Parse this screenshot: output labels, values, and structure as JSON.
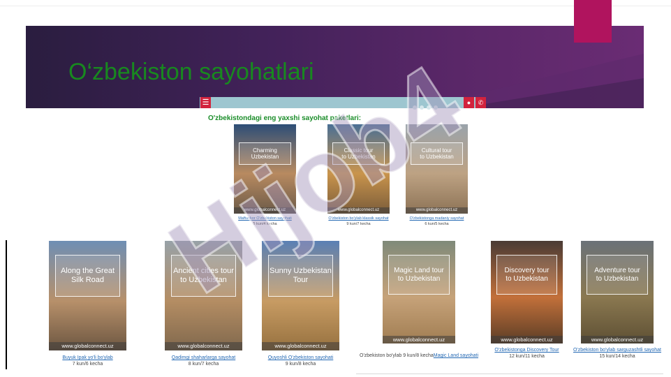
{
  "slide": {
    "title": "O‘zbekiston sayohatlari",
    "colors": {
      "banner": "#43225a",
      "accent": "#b0145e",
      "title": "#18891f",
      "link": "#2368b3",
      "site_bar": "#9dc6d0",
      "site_button": "#d2233d"
    }
  },
  "website": {
    "heading": "O'zbekistondagi eng yaxshi sayohat paketlari:",
    "menu_icon": "hamburger-menu-icon",
    "location_icon": "map-pin-icon",
    "phone_icon": "phone-icon"
  },
  "tours_top": [
    {
      "title": "Charming\nUzbekistan",
      "footer": "www.globalconnect.uz",
      "link": "Maftunkor O'zbekiston sayohati",
      "duration": "5 kun/4 kecha"
    },
    {
      "title": "Classic tour\nto Uzbekistan",
      "footer": "www.globalconnect.uz",
      "link": "O'zbekiston bo'ylab klassik sayohat",
      "duration": "9 kun/7 kecha"
    },
    {
      "title": "Cultural tour\nto Uzbekistan",
      "footer": "www.globalconnect.uz",
      "link": "O'zbekistonga madaniy sayohat",
      "duration": "6 kun/5 kecha"
    }
  ],
  "tours_bottom": [
    {
      "title": "Along the Great\nSilk Road",
      "footer": "www.globalconnect.uz",
      "link": "Buyuk Ipak yo'li bo'ylab",
      "duration": "7 kun/6 kecha"
    },
    {
      "title": "Ancient cities tour\nto Uzbekistan",
      "footer": "www.globalconnect.uz",
      "link": "Qadimgi shaharlarga sayohat",
      "duration": "8 kun/7 kecha"
    },
    {
      "title": "Sunny Uzbekistan\nTour",
      "footer": "www.globalconnect.uz",
      "link": "Quyoshli O'zbekiston sayohati",
      "duration": "9 kun/8 kecha"
    },
    {
      "title": "Magic Land tour\nto Uzbekistan",
      "footer": "www.globalconnect.uz",
      "prefix": "O'zbekiston bo'ylab 9 kun/8 kecha",
      "link": "Magic Land sayohati"
    },
    {
      "title": "Discovery tour\nto Uzbekistan",
      "footer": "www.globalconnect.uz",
      "link": "O'zbekistonga Discovery Tour",
      "duration": "12 kun/11 kecha"
    },
    {
      "title": "Adventure tour\nto Uzbekistan",
      "footer": "www.globalconnect.uz",
      "link": "O'zbekiston bo'ylab sarguzashtli sayohat",
      "duration": "15 kun/14 kecha"
    }
  ],
  "watermark": "Hijob4"
}
